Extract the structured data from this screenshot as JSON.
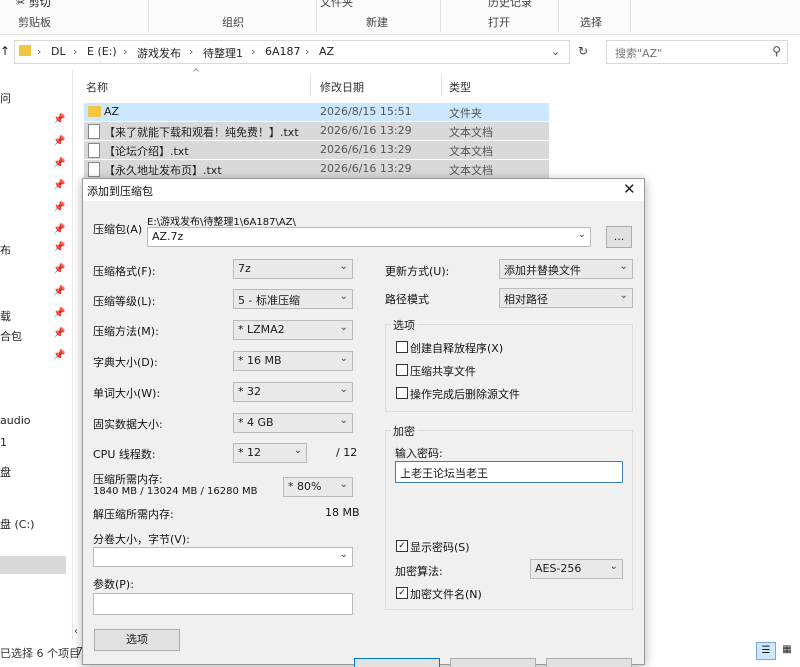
{
  "ribbon": {
    "cut_label": "剪切",
    "clipboard_group": "剪贴板",
    "organize_group": "组织",
    "new_group": "新建",
    "open_group": "打开",
    "select_group": "选择",
    "top_partial_1": "文件夹",
    "top_partial_2": "历史记录"
  },
  "address": {
    "crumbs": [
      "DL",
      "E (E:)",
      "游戏发布",
      "待整理1",
      "6A187",
      "AZ"
    ],
    "search_placeholder": "搜索\"AZ\""
  },
  "nav": {
    "items": [
      "问",
      "布",
      "载",
      "合包",
      "audio",
      "1",
      "盘",
      "盘 (C:)"
    ]
  },
  "columns": {
    "name": "名称",
    "date": "修改日期",
    "type": "类型"
  },
  "files": [
    {
      "name": "AZ",
      "date": "2026/8/15 15:51",
      "type": "文件夹",
      "icon": "folder-icon"
    },
    {
      "name": "【来了就能下载和观看！纯免费！】.txt",
      "date": "2026/6/16 13:29",
      "type": "文本文档",
      "icon": "text-file-icon"
    },
    {
      "name": "【论坛介绍】.txt",
      "date": "2026/6/16 13:29",
      "type": "文本文档",
      "icon": "text-file-icon"
    },
    {
      "name": "【永久地址发布页】.txt",
      "date": "2026/6/16 13:29",
      "type": "文本文档",
      "icon": "text-file-icon"
    }
  ],
  "status": {
    "text": "已选择 6 个项目",
    "extra": "7"
  },
  "dialog": {
    "title": "添加到压缩包",
    "archive_label": "压缩包(A)",
    "archive_path": "E:\\游戏发布\\待整理1\\6A187\\AZ\\",
    "archive_name": "AZ.7z",
    "browse_label": "...",
    "format_label": "压缩格式(F):",
    "format_value": "7z",
    "level_label": "压缩等级(L):",
    "level_value": "5 - 标准压缩",
    "method_label": "压缩方法(M):",
    "method_value": "* LZMA2",
    "dict_label": "字典大小(D):",
    "dict_value": "* 16 MB",
    "word_label": "单词大小(W):",
    "word_value": "* 32",
    "solid_label": "固实数据大小:",
    "solid_value": "* 4 GB",
    "threads_label": "CPU 线程数:",
    "threads_value": "* 12",
    "threads_total": "/ 12",
    "mem_label": "压缩所需内存:",
    "mem_detail": "1840 MB / 13024 MB / 16280 MB",
    "mem_percent": "* 80%",
    "decomp_label": "解压缩所需内存:",
    "decomp_value": "18 MB",
    "volume_label": "分卷大小，字节(V):",
    "params_label": "参数(P):",
    "options_button": "选项",
    "update_label": "更新方式(U):",
    "update_value": "添加并替换文件",
    "pathmode_label": "路径模式",
    "pathmode_value": "相对路径",
    "options_group": "选项",
    "opt_sfx": "创建自释放程序(X)",
    "opt_shared": "压缩共享文件",
    "opt_delete": "操作完成后删除源文件",
    "encrypt_group": "加密",
    "password_label": "输入密码:",
    "password_value": "上老王论坛当老王",
    "show_password": "显示密码(S)",
    "enc_method_label": "加密算法:",
    "enc_method_value": "AES-256",
    "encrypt_names": "加密文件名(N)"
  }
}
